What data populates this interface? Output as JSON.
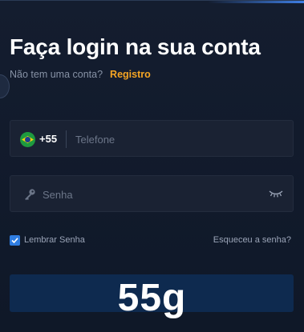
{
  "header": {
    "title": "Faça login na sua conta",
    "no_account_text": "Não tem uma conta?",
    "register_link": "Registro"
  },
  "phone_field": {
    "country_flag": "brazil-flag-icon",
    "dial_code": "+55",
    "placeholder": "Telefone",
    "value": ""
  },
  "password_field": {
    "leading_icon": "key-icon",
    "placeholder": "Senha",
    "value": "",
    "toggle_icon": "eye-closed-icon"
  },
  "options": {
    "remember_label": "Lembrar Senha",
    "remember_checked": true,
    "forgot_link": "Esqueceu a senha?"
  },
  "login_button": {
    "label": ""
  },
  "watermark": {
    "text": "55g"
  },
  "colors": {
    "background": "#111a2b",
    "field_background": "#1a2233",
    "accent_orange": "#f5a524",
    "checkbox_blue": "#2f7de1",
    "button_background": "#0e2a4f"
  }
}
